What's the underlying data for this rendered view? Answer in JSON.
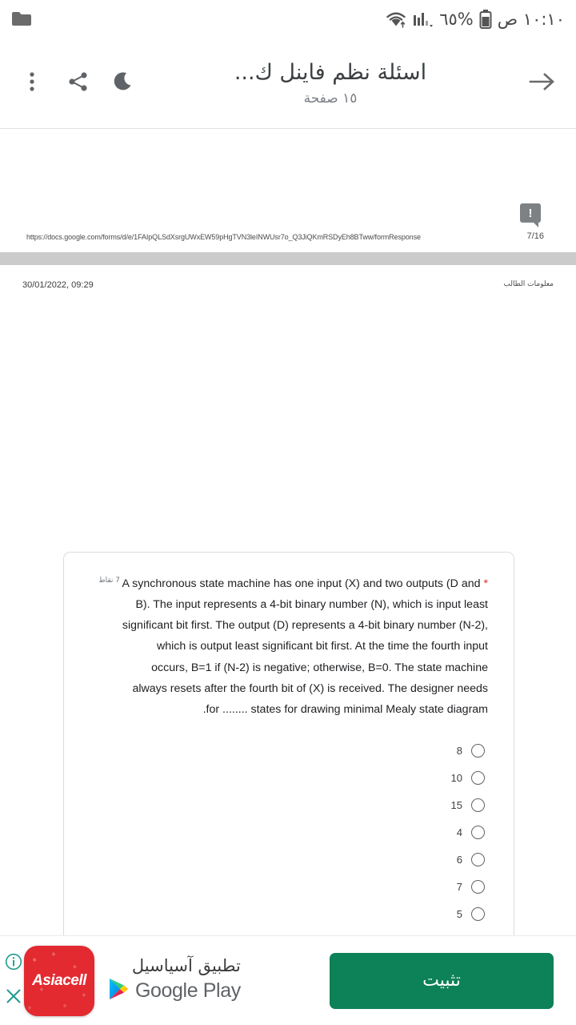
{
  "status_bar": {
    "time": "١٠:١٠ ص",
    "battery_percent": "%٦٥",
    "icons": [
      "battery-icon",
      "signal-icon",
      "wifi-icon",
      "folder-icon"
    ]
  },
  "app_bar": {
    "back_icon": "arrow-right-icon",
    "title": "اسئلة نظم فاينل ك...",
    "subtitle": "١٥ صفحة",
    "actions": [
      "night-mode-icon",
      "share-icon",
      "overflow-menu-icon"
    ]
  },
  "document": {
    "previous_page": {
      "url": "https://docs.google.com/forms/d/e/1FAIpQLSdXsrgUWxEW59pHgTVN3leINWUsr7o_Q3JiQKmRSDyEh8BTww/formResponse",
      "page_number": "7/16",
      "tooltip_badge": "!"
    },
    "current_page": {
      "date": "30/01/2022, 09:29",
      "header_arabic": "معلومات الطالب"
    },
    "question": {
      "points": "7 نقاط",
      "text": "A synchronous state machine has one input (X) and two outputs (D and B). The input represents a 4-bit binary number (N), which is input least significant bit first. The output (D) represents a 4-bit binary number (N-2), which is output least significant bit first. At the time the fourth input occurs, B=1 if (N-2) is negative; otherwise, B=0. The state machine always resets after the fourth bit of (X) is received. The designer needs for ........ states for drawing minimal Mealy state diagram.",
      "required_marker": "*",
      "options": [
        {
          "label": "8",
          "selected": false
        },
        {
          "label": "10",
          "selected": false
        },
        {
          "label": "15",
          "selected": false
        },
        {
          "label": "4",
          "selected": false
        },
        {
          "label": "6",
          "selected": false
        },
        {
          "label": "7",
          "selected": false
        },
        {
          "label": "5",
          "selected": false
        }
      ]
    }
  },
  "ad_banner": {
    "app_icon_text": "Asiacell",
    "title": "تطبيق آسياسيل",
    "store_name": "Google Play",
    "store_icon": "google-play-icon",
    "cta_label": "تثبيت",
    "info_icon": "info-icon",
    "close_icon": "close-icon",
    "cta_color": "#0d8157",
    "icon_color": "#e22a30"
  }
}
